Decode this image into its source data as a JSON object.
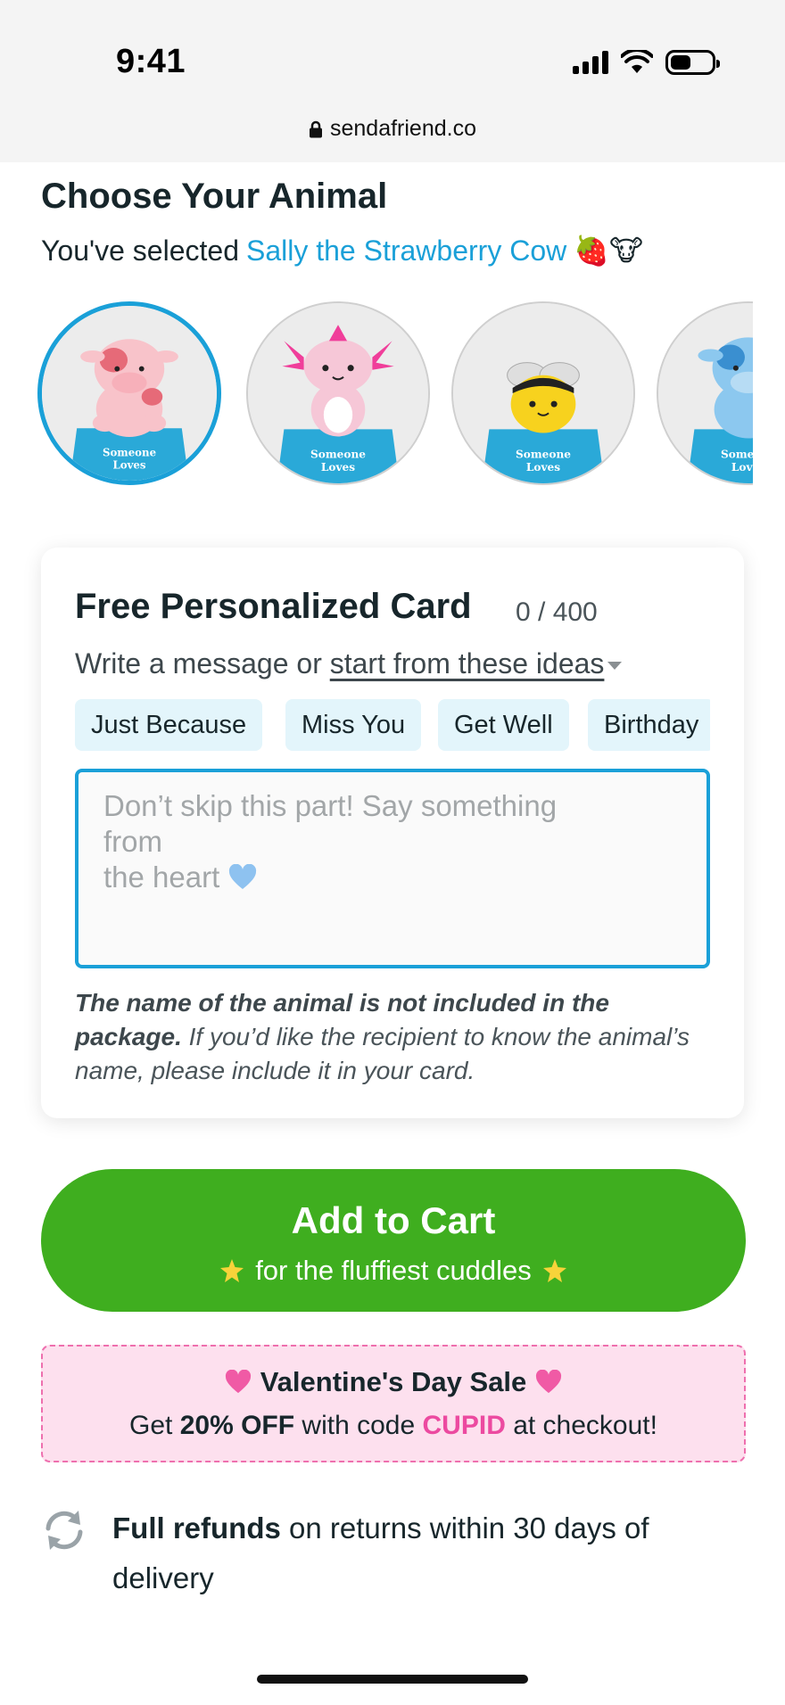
{
  "status_bar": {
    "time": "9:41"
  },
  "browser": {
    "url": "sendafriend.co"
  },
  "animal_picker": {
    "title": "Choose Your Animal",
    "selected_prefix": "You've selected",
    "selected_name": "Sally the Strawberry Cow",
    "selected_emoji": "🍓🐮",
    "animals": [
      {
        "name": "strawberry-cow",
        "box_text": "Someone Loves",
        "selected": true,
        "body_color": "#f8c3ca",
        "accent_color": "#e66a78"
      },
      {
        "name": "axolotl",
        "box_text": "Someone Loves",
        "selected": false,
        "body_color": "#f6c7d7",
        "accent_color": "#f03e9a"
      },
      {
        "name": "bee",
        "box_text": "Someone Loves",
        "selected": false,
        "body_color": "#f7d21e",
        "accent_color": "#222222"
      },
      {
        "name": "blue-cow",
        "box_text": "Someone Loves",
        "selected": false,
        "body_color": "#8cc8ef",
        "accent_color": "#3a8fd0"
      }
    ]
  },
  "card": {
    "title": "Free Personalized Card",
    "counter": "0 / 400",
    "subtitle_prefix": "Write a message or",
    "ideas_link": "start from these ideas",
    "chips": [
      "Just Because",
      "Miss You",
      "Get Well",
      "Birthday"
    ],
    "placeholder_line1": "Don’t skip this part! Say something",
    "placeholder_line2": "from",
    "placeholder_line3": "the heart",
    "note_bold": "The name of the animal is not included in the package.",
    "note_rest": " If you’d like the recipient to know the animal’s name, please include it in your card."
  },
  "cart_button": {
    "label": "Add to Cart",
    "sub": "for the fluffiest cuddles"
  },
  "sale_banner": {
    "headline": "Valentine's Day Sale",
    "get": "Get ",
    "discount": "20% OFF",
    "with_code": " with code ",
    "code": "CUPID",
    "at_checkout": " at checkout!"
  },
  "refund": {
    "bold": "Full refunds",
    "rest": " on returns within 30 days of delivery"
  },
  "colors": {
    "accent_blue": "#1aa0d8",
    "cart_green": "#3fae1f",
    "sale_pink": "#ec4aa0"
  }
}
